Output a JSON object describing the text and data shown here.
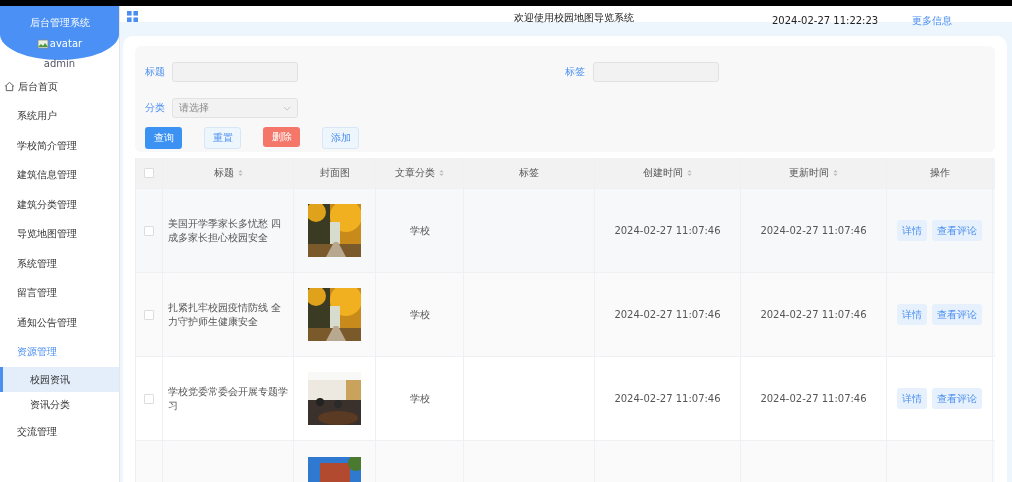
{
  "sidebar": {
    "title": "后台管理系统",
    "avatar_alt": "avatar",
    "username": "admin",
    "items": [
      {
        "label": "后台首页",
        "kind": "home",
        "selected": false
      },
      {
        "label": "系统用户",
        "selected": false
      },
      {
        "label": "学校简介管理",
        "selected": false
      },
      {
        "label": "建筑信息管理",
        "selected": false
      },
      {
        "label": "建筑分类管理",
        "selected": false
      },
      {
        "label": "导览地图管理",
        "selected": false
      },
      {
        "label": "系统管理",
        "selected": false
      },
      {
        "label": "留言管理",
        "selected": false
      },
      {
        "label": "通知公告管理",
        "selected": false
      },
      {
        "label": "资源管理",
        "selected": false,
        "expanded": true,
        "children": [
          {
            "label": "校园资讯",
            "selected": true
          },
          {
            "label": "资讯分类",
            "selected": false
          }
        ]
      },
      {
        "label": "交流管理",
        "selected": false
      }
    ]
  },
  "header": {
    "title": "欢迎使用校园地图导览系统",
    "datetime": "2024-02-27 11:22:23",
    "more_link": "更多信息"
  },
  "filters": {
    "title_label": "标题",
    "tag_label": "标签",
    "category_label": "分类",
    "category_placeholder": "请选择"
  },
  "buttons": [
    {
      "label": "查询",
      "kind": "primary"
    },
    {
      "label": "重置",
      "kind": "plain"
    },
    {
      "label": "删除",
      "kind": "danger"
    },
    {
      "label": "添加",
      "kind": "plain"
    }
  ],
  "table": {
    "select_all_checked": false,
    "columns": [
      {
        "label": "标题",
        "sortable": true
      },
      {
        "label": "封面图",
        "sortable": false
      },
      {
        "label": "文章分类",
        "sortable": true
      },
      {
        "label": "标签",
        "sortable": false
      },
      {
        "label": "创建时间",
        "sortable": true
      },
      {
        "label": "更新时间",
        "sortable": true
      },
      {
        "label": "操作",
        "sortable": false
      }
    ],
    "rows": [
      {
        "checked": false,
        "title": "美国开学季家长多忧愁 四成多家长担心校园安全",
        "cover": {
          "kind": "picture"
        },
        "category": "学校",
        "created": "2024-02-27 11:07:46",
        "updated": "2024-02-27 11:07:46",
        "actions": [
          "详情",
          "查看评论"
        ]
      },
      {
        "checked": false,
        "title": "扎紧扎牢校园疫情防线 全力守护师生健康安全",
        "cover": {
          "kind": "picture"
        },
        "category": "学校",
        "created": "2024-02-27 11:07:46",
        "updated": "2024-02-27 11:07:46",
        "actions": [
          "详情",
          "查看评论"
        ]
      },
      {
        "checked": false,
        "title": "学校党委常委会开展专题学习",
        "cover": {
          "kind": "picture"
        },
        "category": "学校",
        "created": "2024-02-27 11:07:46",
        "updated": "2024-02-27 11:07:46",
        "actions": [
          "详情",
          "查看评论"
        ]
      },
      {
        "cover": {
          "kind": "picture"
        }
      }
    ]
  }
}
